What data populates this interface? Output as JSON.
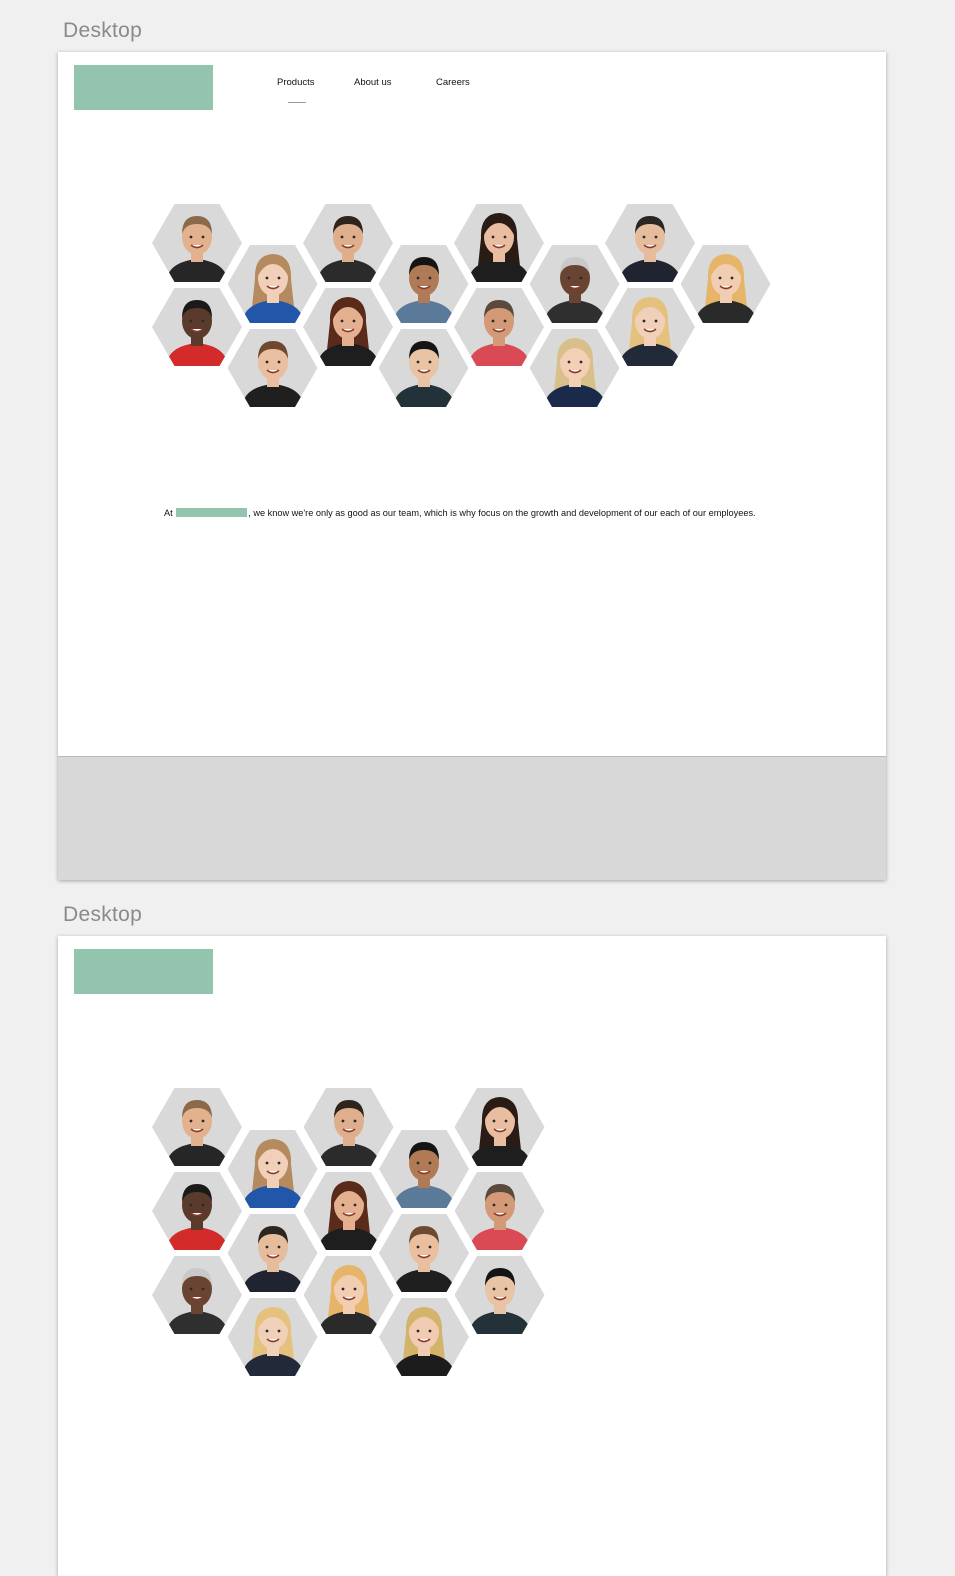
{
  "colors": {
    "canvas": "#f0f0f0",
    "logo": "#93c4ae",
    "redaction": "#93c4ae",
    "hex_background": "#d9d9d9",
    "footer": "#d8d8d8"
  },
  "artboards": [
    {
      "label": "Desktop",
      "nav": {
        "items": [
          {
            "label": "Products",
            "active": true
          },
          {
            "label": "About us",
            "active": false
          },
          {
            "label": "Careers",
            "active": false
          }
        ]
      },
      "tagline": {
        "prefix": "At",
        "suffix": ", we know we're only as good as our team, which is why focus on the growth and development of our each of our employees."
      }
    },
    {
      "label": "Desktop"
    }
  ],
  "avatars": [
    {
      "bg": "#dcdcdc",
      "skin": "#e2b28f",
      "hair": "#8a6a4a",
      "shirt": "#262626",
      "long_hair": false
    },
    {
      "bg": "#dcdcdc",
      "skin": "#f1cfb9",
      "hair": "#b48a5e",
      "shirt": "#2256a8",
      "long_hair": true
    },
    {
      "bg": "#dcdcdc",
      "skin": "#dfae8c",
      "hair": "#2e241c",
      "shirt": "#2b2b2b",
      "long_hair": false
    },
    {
      "bg": "#dcdcdc",
      "skin": "#b07a56",
      "hair": "#151515",
      "shirt": "#5b7a99",
      "long_hair": false
    },
    {
      "bg": "#dcdcdc",
      "skin": "#e8bda0",
      "hair": "#2a1b14",
      "shirt": "#1e1e1e",
      "long_hair": true
    },
    {
      "bg": "#dcdcdc",
      "skin": "#6a4432",
      "hair": "#c9c9c9",
      "shirt": "#2f2f2f",
      "long_hair": false
    },
    {
      "bg": "#dcdcdc",
      "skin": "#e5bd9d",
      "hair": "#2c2520",
      "shirt": "#1f2430",
      "long_hair": false
    },
    {
      "bg": "#dcdcdc",
      "skin": "#f1cdb2",
      "hair": "#e6b56a",
      "shirt": "#2a2a2a",
      "long_hair": true
    },
    {
      "bg": "#dcdcdc",
      "skin": "#5a3a2a",
      "hair": "#1a1a1a",
      "shirt": "#d32a2a",
      "long_hair": false
    },
    {
      "bg": "#dcdcdc",
      "skin": "#e9bfa0",
      "hair": "#6d4a2f",
      "shirt": "#1f1f1f",
      "long_hair": false
    },
    {
      "bg": "#dcdcdc",
      "skin": "#e4b090",
      "hair": "#5a2a1a",
      "shirt": "#1e1e1e",
      "long_hair": true
    },
    {
      "bg": "#dcdcdc",
      "skin": "#e8c3a4",
      "hair": "#141414",
      "shirt": "#233238",
      "long_hair": false
    },
    {
      "bg": "#dcdcdc",
      "skin": "#d49a78",
      "hair": "#5a4a3e",
      "shirt": "#d94a55",
      "long_hair": false
    },
    {
      "bg": "#dcdcdc",
      "skin": "#f0d0b8",
      "hair": "#e4c27e",
      "shirt": "#222a3a",
      "long_hair": true
    },
    {
      "bg": "#dcdcdc",
      "skin": "#f2cbb3",
      "hair": "#d4b36a",
      "shirt": "#1c1c1c",
      "long_hair": true
    },
    {
      "bg": "#dcdcdc",
      "skin": "#f3cfb6",
      "hair": "#d9c08a",
      "shirt": "#1a2a4a",
      "long_hair": true
    }
  ]
}
